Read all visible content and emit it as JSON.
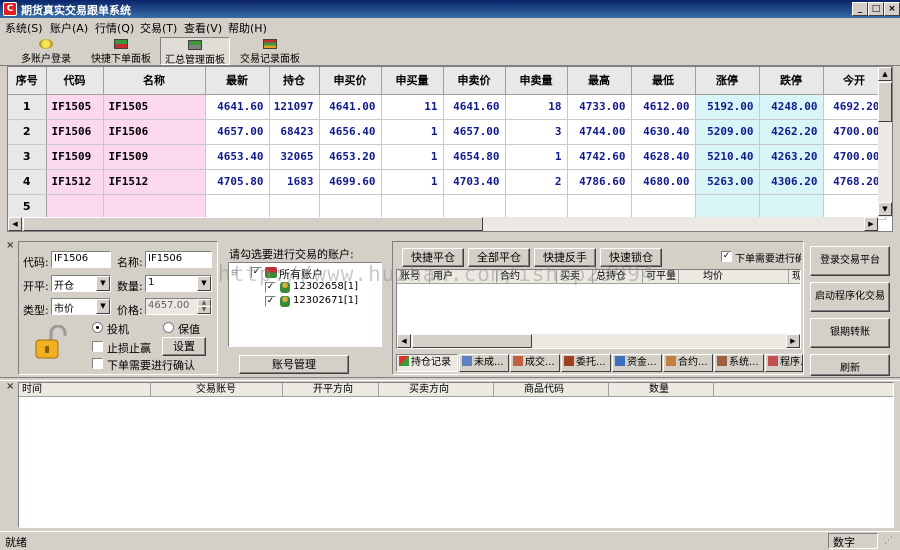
{
  "window": {
    "title": "期货真实交易跟单系统",
    "min": "_",
    "max": "□",
    "close": "×"
  },
  "menu": [
    "系统(S)",
    "账户(A)",
    "行情(Q)",
    "交易(T)",
    "查看(V)",
    "帮助(H)"
  ],
  "toolbar": [
    "多账户登录",
    "快捷下单面板",
    "汇总管理面板",
    "交易记录面板"
  ],
  "quote_table": {
    "columns": [
      "序号",
      "代码",
      "名称",
      "最新",
      "持仓",
      "申买价",
      "申买量",
      "申卖价",
      "申卖量",
      "最高",
      "最低",
      "涨停",
      "跌停",
      "今开"
    ],
    "rows": [
      [
        "1",
        "IF1505",
        "IF1505",
        "4641.60",
        "121097",
        "4641.00",
        "11",
        "4641.60",
        "18",
        "4733.00",
        "4612.00",
        "5192.00",
        "4248.00",
        "4692.20"
      ],
      [
        "2",
        "IF1506",
        "IF1506",
        "4657.00",
        "68423",
        "4656.40",
        "1",
        "4657.00",
        "3",
        "4744.00",
        "4630.40",
        "5209.00",
        "4262.20",
        "4700.00"
      ],
      [
        "3",
        "IF1509",
        "IF1509",
        "4653.40",
        "32065",
        "4653.20",
        "1",
        "4654.80",
        "1",
        "4742.60",
        "4628.40",
        "5210.40",
        "4263.20",
        "4700.00"
      ],
      [
        "4",
        "IF1512",
        "IF1512",
        "4705.80",
        "1683",
        "4699.60",
        "1",
        "4703.40",
        "2",
        "4786.60",
        "4680.00",
        "5263.00",
        "4306.20",
        "4768.20"
      ],
      [
        "5",
        "",
        "",
        "",
        "",
        "",
        "",
        "",
        "",
        "",
        "",
        "",
        "",
        ""
      ]
    ]
  },
  "order": {
    "code_label": "代码:",
    "code_value": "IF1506",
    "name_label": "名称:",
    "name_value": "IF1506",
    "openclose_label": "开平:",
    "openclose_value": "开仓",
    "qty_label": "数量:",
    "qty_value": "1",
    "type_label": "类型:",
    "type_value": "市价",
    "price_label": "价格:",
    "price_value": "4657.00",
    "radio_speculate": "投机",
    "radio_hedge": "保值",
    "stoploss": "止损止赢",
    "settings": "设置",
    "confirm": "下单需要进行确认"
  },
  "accounts": {
    "prompt": "请勾选要进行交易的账户:",
    "root": "所有账户",
    "items": [
      "12302658[1]",
      "12302671[1]"
    ],
    "manage_button": "账号管理"
  },
  "positions": {
    "buttons": [
      "快捷平仓",
      "全部平仓",
      "快捷反手",
      "快速锁仓"
    ],
    "confirm": "下单需要进行确认",
    "columns": [
      "账号",
      "用户",
      "合约",
      "买卖",
      "总持仓",
      "可平量",
      "均价",
      "现"
    ],
    "tabs": [
      "持仓记录",
      "未成...",
      "成交...",
      "委托...",
      "资金...",
      "合约...",
      "系统...",
      "程序..."
    ]
  },
  "side_buttons": [
    "登录交易平台",
    "启动程序化交易",
    "银期转账",
    "刷新"
  ],
  "log": {
    "columns": [
      "时间",
      "交易账号",
      "开平方向",
      "买卖方向",
      "商品代码",
      "数量"
    ]
  },
  "status": {
    "left": "就绪",
    "right": "数字"
  },
  "watermark": "http://www.huzhan.com/ishop23994",
  "colors": {
    "title_bar": "#0a246a",
    "pink_cell": "#fbd8f0",
    "cyan_cell": "#d9f5f7",
    "quote_text": "#101a8a"
  }
}
